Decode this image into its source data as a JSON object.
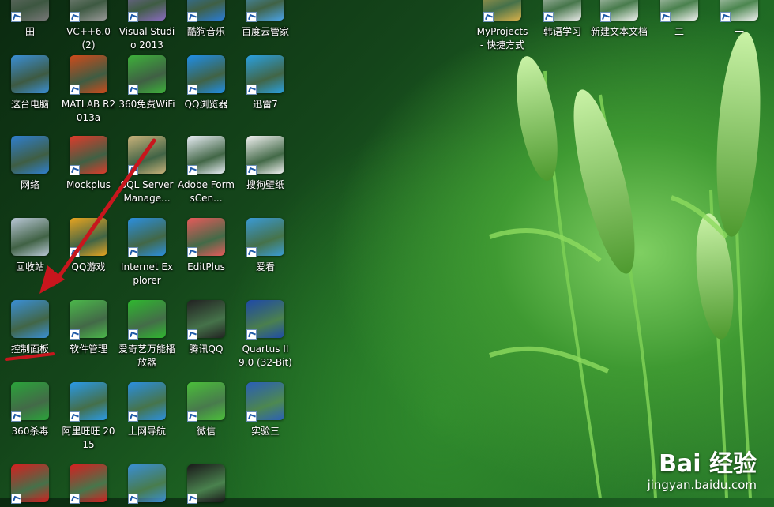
{
  "desktop": {
    "icons": [
      {
        "label": "田",
        "icon": "partial-icon",
        "color": "#777"
      },
      {
        "label": "VC++6.0 (2)",
        "icon": "vc-icon",
        "color": "#999"
      },
      {
        "label": "Visual Studio 2013",
        "icon": "vs-icon",
        "color": "#8a6bbf"
      },
      {
        "label": "酷狗音乐",
        "icon": "kugou-icon",
        "color": "#2a7cd6"
      },
      {
        "label": "百度云管家",
        "icon": "baidu-cloud-icon",
        "color": "#4aa3e8"
      },
      {
        "label": "这台电脑",
        "icon": "computer-icon",
        "color": "#3a8fd6"
      },
      {
        "label": "MATLAB R2013a",
        "icon": "matlab-icon",
        "color": "#d04a1a"
      },
      {
        "label": "360免费WiFi",
        "icon": "wifi-icon",
        "color": "#3db13a"
      },
      {
        "label": "QQ浏览器",
        "icon": "qq-browser-icon",
        "color": "#1f8ee8"
      },
      {
        "label": "迅雷7",
        "icon": "thunder-icon",
        "color": "#2aa0e0"
      },
      {
        "label": "网络",
        "icon": "network-icon",
        "color": "#2f7fd0"
      },
      {
        "label": "Mockplus",
        "icon": "mockplus-icon",
        "color": "#e03a2a"
      },
      {
        "label": "SQL Server Manage...",
        "icon": "sql-server-icon",
        "color": "#c9b27a"
      },
      {
        "label": "Adobe FormsCen...",
        "icon": "adobe-forms-icon",
        "color": "#e9eef5"
      },
      {
        "label": "搜狗壁纸",
        "icon": "sogou-wallpaper-icon",
        "color": "#f2f2f2"
      },
      {
        "label": "回收站",
        "icon": "recycle-bin-icon",
        "color": "#b9c7d6"
      },
      {
        "label": "QQ游戏",
        "icon": "qq-game-icon",
        "color": "#e8a41f"
      },
      {
        "label": "Internet Explorer",
        "icon": "ie-icon",
        "color": "#2b8fe0"
      },
      {
        "label": "EditPlus",
        "icon": "editplus-icon",
        "color": "#e85a5a"
      },
      {
        "label": "爱看",
        "icon": "aikan-icon",
        "color": "#3a9bd6"
      },
      {
        "label": "控制面板",
        "icon": "control-panel-icon",
        "color": "#3a8fd6"
      },
      {
        "label": "软件管理",
        "icon": "software-manager-icon",
        "color": "#4bb84a"
      },
      {
        "label": "爱奇艺万能播放器",
        "icon": "iqiyi-icon",
        "color": "#2fb82f"
      },
      {
        "label": "腾讯QQ",
        "icon": "qq-icon",
        "color": "#222"
      },
      {
        "label": "Quartus II 9.0 (32-Bit)",
        "icon": "quartus-icon",
        "color": "#1f4aa8"
      },
      {
        "label": "360杀毒",
        "icon": "360-antivirus-icon",
        "color": "#2aa43a"
      },
      {
        "label": "阿里旺旺 2015",
        "icon": "aliwangwang-icon",
        "color": "#2a9ae8"
      },
      {
        "label": "上网导航",
        "icon": "ie-nav-icon",
        "color": "#2b8fe0"
      },
      {
        "label": "微信",
        "icon": "wechat-icon",
        "color": "#4bbf3a"
      },
      {
        "label": "实验三",
        "icon": "word-doc-icon",
        "color": "#2b5fb8"
      },
      {
        "label": "MyProjects - 快捷方式",
        "icon": "folder-shortcut-icon",
        "color": "#d8b04a"
      },
      {
        "label": "韩语学习",
        "icon": "folder-icon",
        "color": "#e8e8e8"
      },
      {
        "label": "新建文本文档",
        "icon": "text-doc-icon",
        "color": "#f0f0f0"
      },
      {
        "label": "二",
        "icon": "text-doc-icon",
        "color": "#f0f0f0"
      },
      {
        "label": "一",
        "icon": "text-doc-icon",
        "color": "#f0f0f0"
      },
      {
        "label": "",
        "icon": "pdf-icon",
        "color": "#d62020"
      },
      {
        "label": "",
        "icon": "xiu-icon",
        "color": "#d62020"
      },
      {
        "label": "",
        "icon": "notepad-icon",
        "color": "#3a8fd6"
      },
      {
        "label": "",
        "icon": "chip-8086-icon",
        "color": "#1a1a1a"
      }
    ]
  },
  "annotation": {
    "arrow_color": "#c8161d",
    "underline_color": "#c8161d"
  },
  "watermark": {
    "brand": "Bai 经验",
    "url": "jingyan.baidu.com"
  }
}
